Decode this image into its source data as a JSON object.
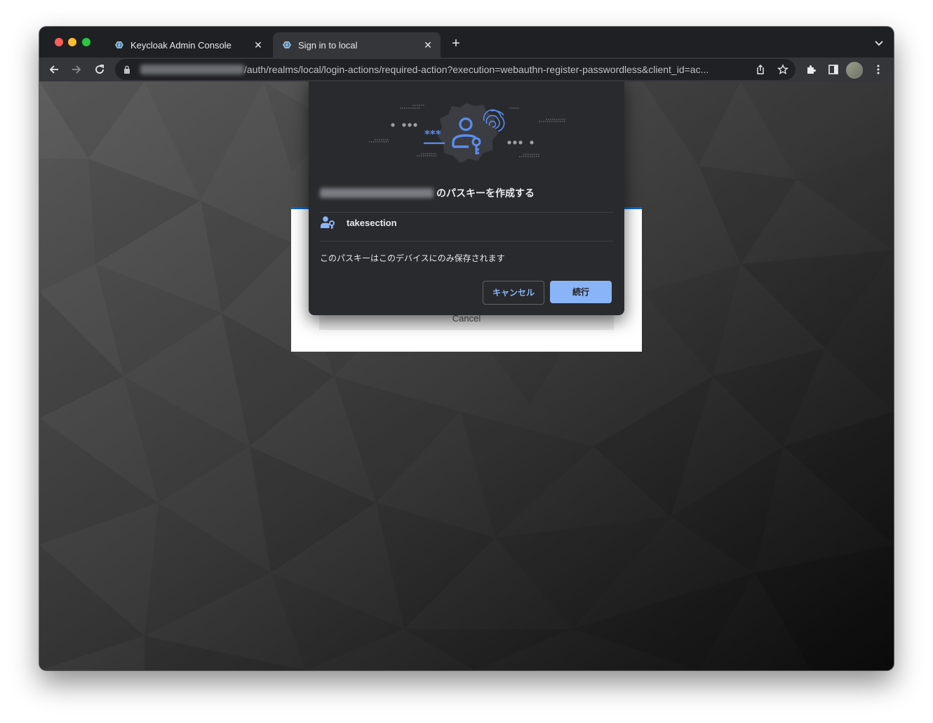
{
  "browser": {
    "tabs": [
      {
        "label": "Keycloak Admin Console",
        "active": false
      },
      {
        "label": "Sign in to local",
        "active": true
      }
    ],
    "url_visible": "/auth/realms/local/login-actions/required-action?execution=webauthn-register-passwordless&client_id=ac..."
  },
  "page": {
    "card_cancel_label": "Cancel"
  },
  "passkey_dialog": {
    "title_suffix": "のパスキーを作成する",
    "account_name": "takesection",
    "note": "このパスキーはこのデバイスにのみ保存されます",
    "cancel_label": "キャンセル",
    "continue_label": "続行"
  },
  "colors": {
    "accent": "#8ab4f8",
    "dialog_bg": "#292a2d",
    "illustration_blue": "#5b8def"
  },
  "icons": [
    "back-icon",
    "forward-icon",
    "reload-icon",
    "lock-icon",
    "share-icon",
    "star-icon",
    "extensions-icon",
    "sidepanel-icon",
    "menu-icon",
    "passkey-icon",
    "fingerprint-icon",
    "account-key-icon"
  ]
}
